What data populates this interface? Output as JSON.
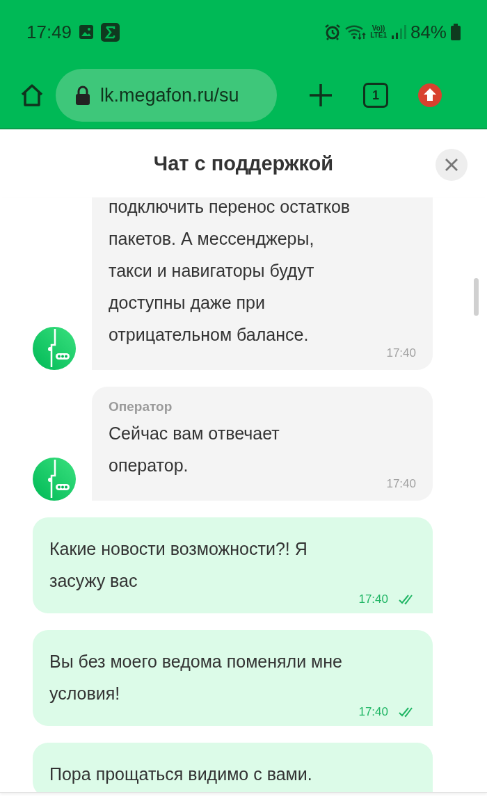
{
  "status_bar": {
    "time": "17:49",
    "network": "Vo))\nLTE1",
    "battery": "84%"
  },
  "browser": {
    "url": "lk.megafon.ru/su",
    "tab_count": "1"
  },
  "chat": {
    "title": "Чат с поддержкой",
    "messages": [
      {
        "kind": "bot",
        "text": "подключить перенос остатков пакетов. А мессенджеры, такси и навигаторы будут доступны даже при отрицательном балансе.",
        "time": "17:40"
      },
      {
        "kind": "bot",
        "sender": "Оператор",
        "text": "Сейчас вам отвечает оператор.",
        "time": "17:40"
      },
      {
        "kind": "user",
        "text": "Какие новости возможности?! Я засужу вас",
        "time": "17:40",
        "read": true
      },
      {
        "kind": "user",
        "text": "Вы без моего ведома поменяли мне условия!",
        "time": "17:40",
        "read": true
      },
      {
        "kind": "user",
        "text": "Пора прощаться видимо с вами."
      }
    ]
  }
}
